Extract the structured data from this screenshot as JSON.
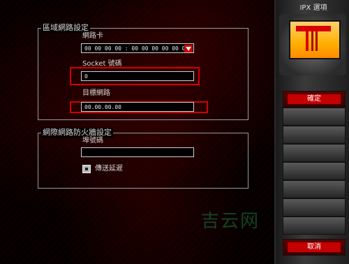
{
  "lan_settings": {
    "group_title": "區域網路設定",
    "network_card_label": "網路卡",
    "network_card_value": "00 00 00 00 : 00 00 00 00 00 00",
    "socket_label": "Socket 號碼",
    "socket_value": "0",
    "target_network_label": "目標網路",
    "target_network_value": "00.00.00.00"
  },
  "firewall": {
    "group_title": "網際網路防火牆設定",
    "port_label": "埠號碼",
    "port_value": "",
    "send_delay_label": "傳送延遲"
  },
  "sidebar": {
    "title": "IPX 選項",
    "ok_label": "確定",
    "cancel_label": "取消"
  },
  "watermark": "吉云网",
  "colors": {
    "accent": "#c40000",
    "highlight": "#d40000"
  }
}
